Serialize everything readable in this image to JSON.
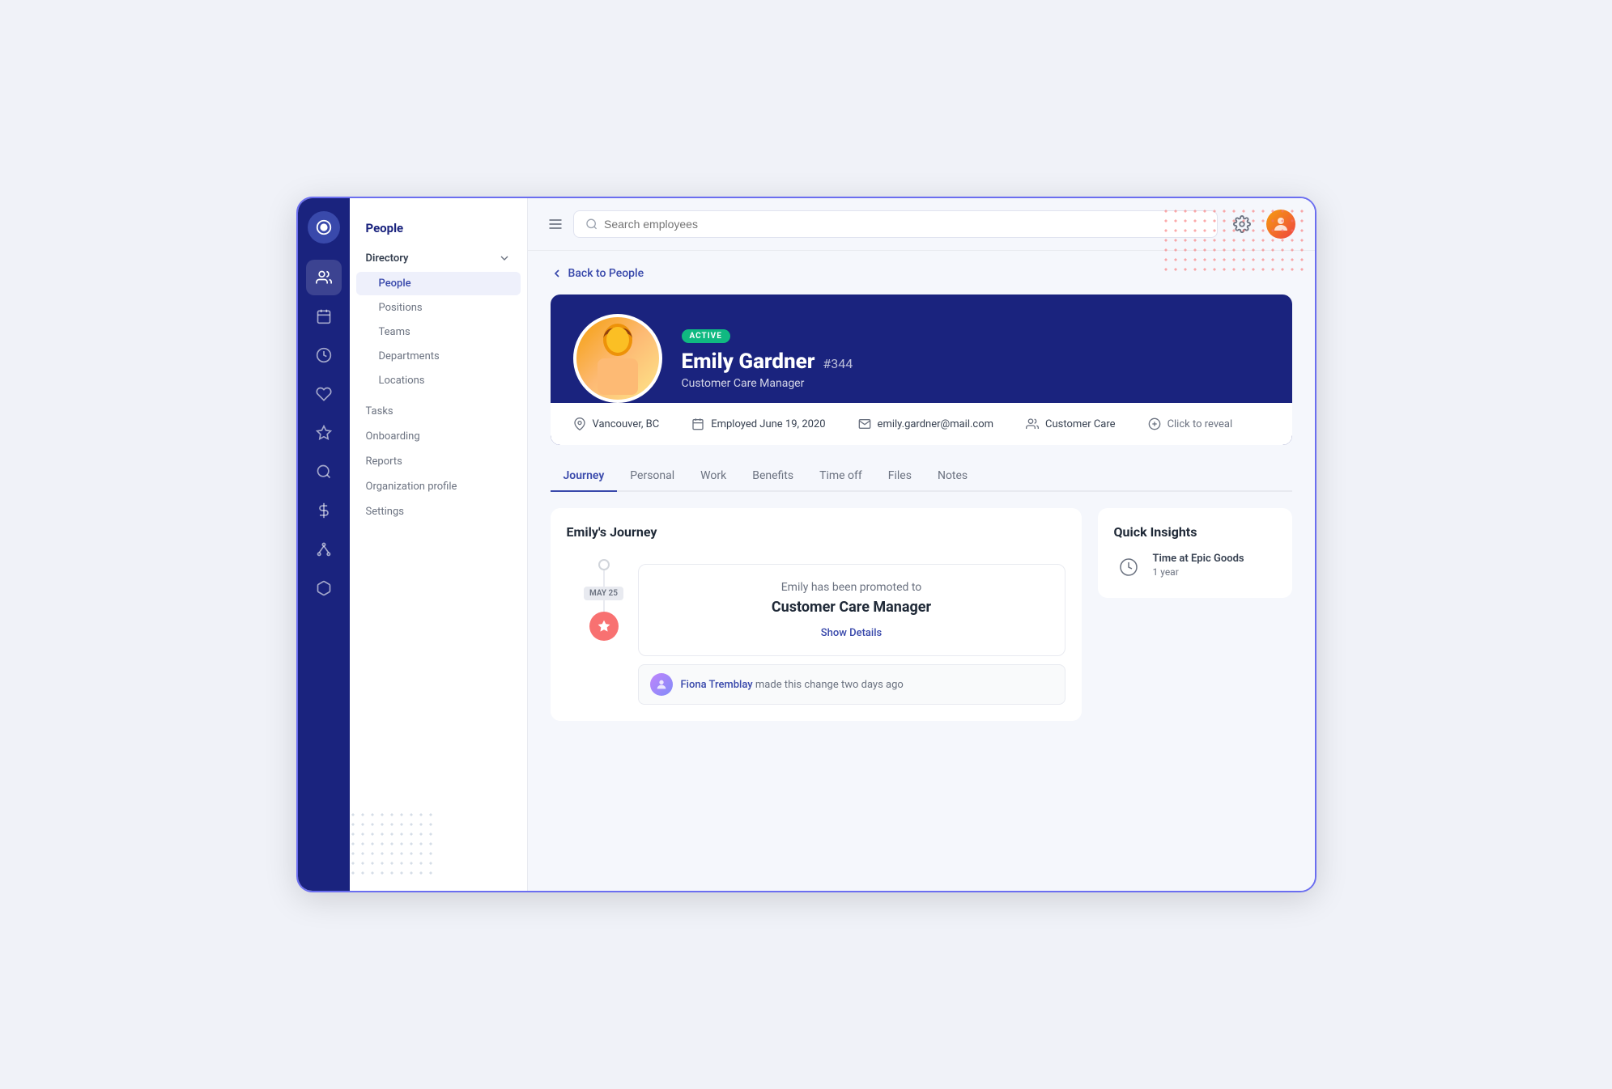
{
  "app": {
    "title": "People"
  },
  "icon_sidebar": {
    "items": [
      {
        "name": "logo",
        "icon": "circle"
      },
      {
        "name": "people",
        "icon": "users",
        "active": true
      },
      {
        "name": "calendar",
        "icon": "calendar"
      },
      {
        "name": "clock",
        "icon": "clock"
      },
      {
        "name": "heart",
        "icon": "heart"
      },
      {
        "name": "star",
        "icon": "star"
      },
      {
        "name": "search",
        "icon": "search"
      },
      {
        "name": "dollar",
        "icon": "dollar"
      },
      {
        "name": "network",
        "icon": "network"
      },
      {
        "name": "box",
        "icon": "box"
      }
    ]
  },
  "nav_sidebar": {
    "section_title": "People",
    "groups": [
      {
        "name": "Directory",
        "expandable": true,
        "items": [
          {
            "label": "People",
            "active": true
          },
          {
            "label": "Positions",
            "active": false
          },
          {
            "label": "Teams",
            "active": false
          },
          {
            "label": "Departments",
            "active": false
          },
          {
            "label": "Locations",
            "active": false
          }
        ]
      }
    ],
    "standalone": [
      "Tasks",
      "Onboarding",
      "Reports",
      "Organization profile",
      "Settings"
    ]
  },
  "topbar": {
    "search_placeholder": "Search employees",
    "menu_label": "Menu"
  },
  "breadcrumb": {
    "back_label": "Back to People"
  },
  "employee": {
    "status": "ACTIVE",
    "name": "Emily Gardner",
    "id": "#344",
    "title": "Customer Care Manager",
    "location": "Vancouver, BC",
    "department": "Customer Care",
    "employed_date": "Employed June 19, 2020",
    "salary": "Click to reveal",
    "email": "emily.gardner@mail.com"
  },
  "tabs": [
    {
      "label": "Journey",
      "active": true
    },
    {
      "label": "Personal",
      "active": false
    },
    {
      "label": "Work",
      "active": false
    },
    {
      "label": "Benefits",
      "active": false
    },
    {
      "label": "Time off",
      "active": false
    },
    {
      "label": "Files",
      "active": false
    },
    {
      "label": "Notes",
      "active": false
    }
  ],
  "journey": {
    "title": "Emily's Journey",
    "timeline_date": "MAY 25",
    "event_text": "Emily has been promoted to",
    "event_title": "Customer Care Manager",
    "show_details_label": "Show Details",
    "change_author": "Fiona Tremblay",
    "change_text": "made this change two days ago"
  },
  "quick_insights": {
    "title": "Quick Insights",
    "items": [
      {
        "label": "Time at Epic Goods",
        "value": "1 year"
      }
    ]
  }
}
